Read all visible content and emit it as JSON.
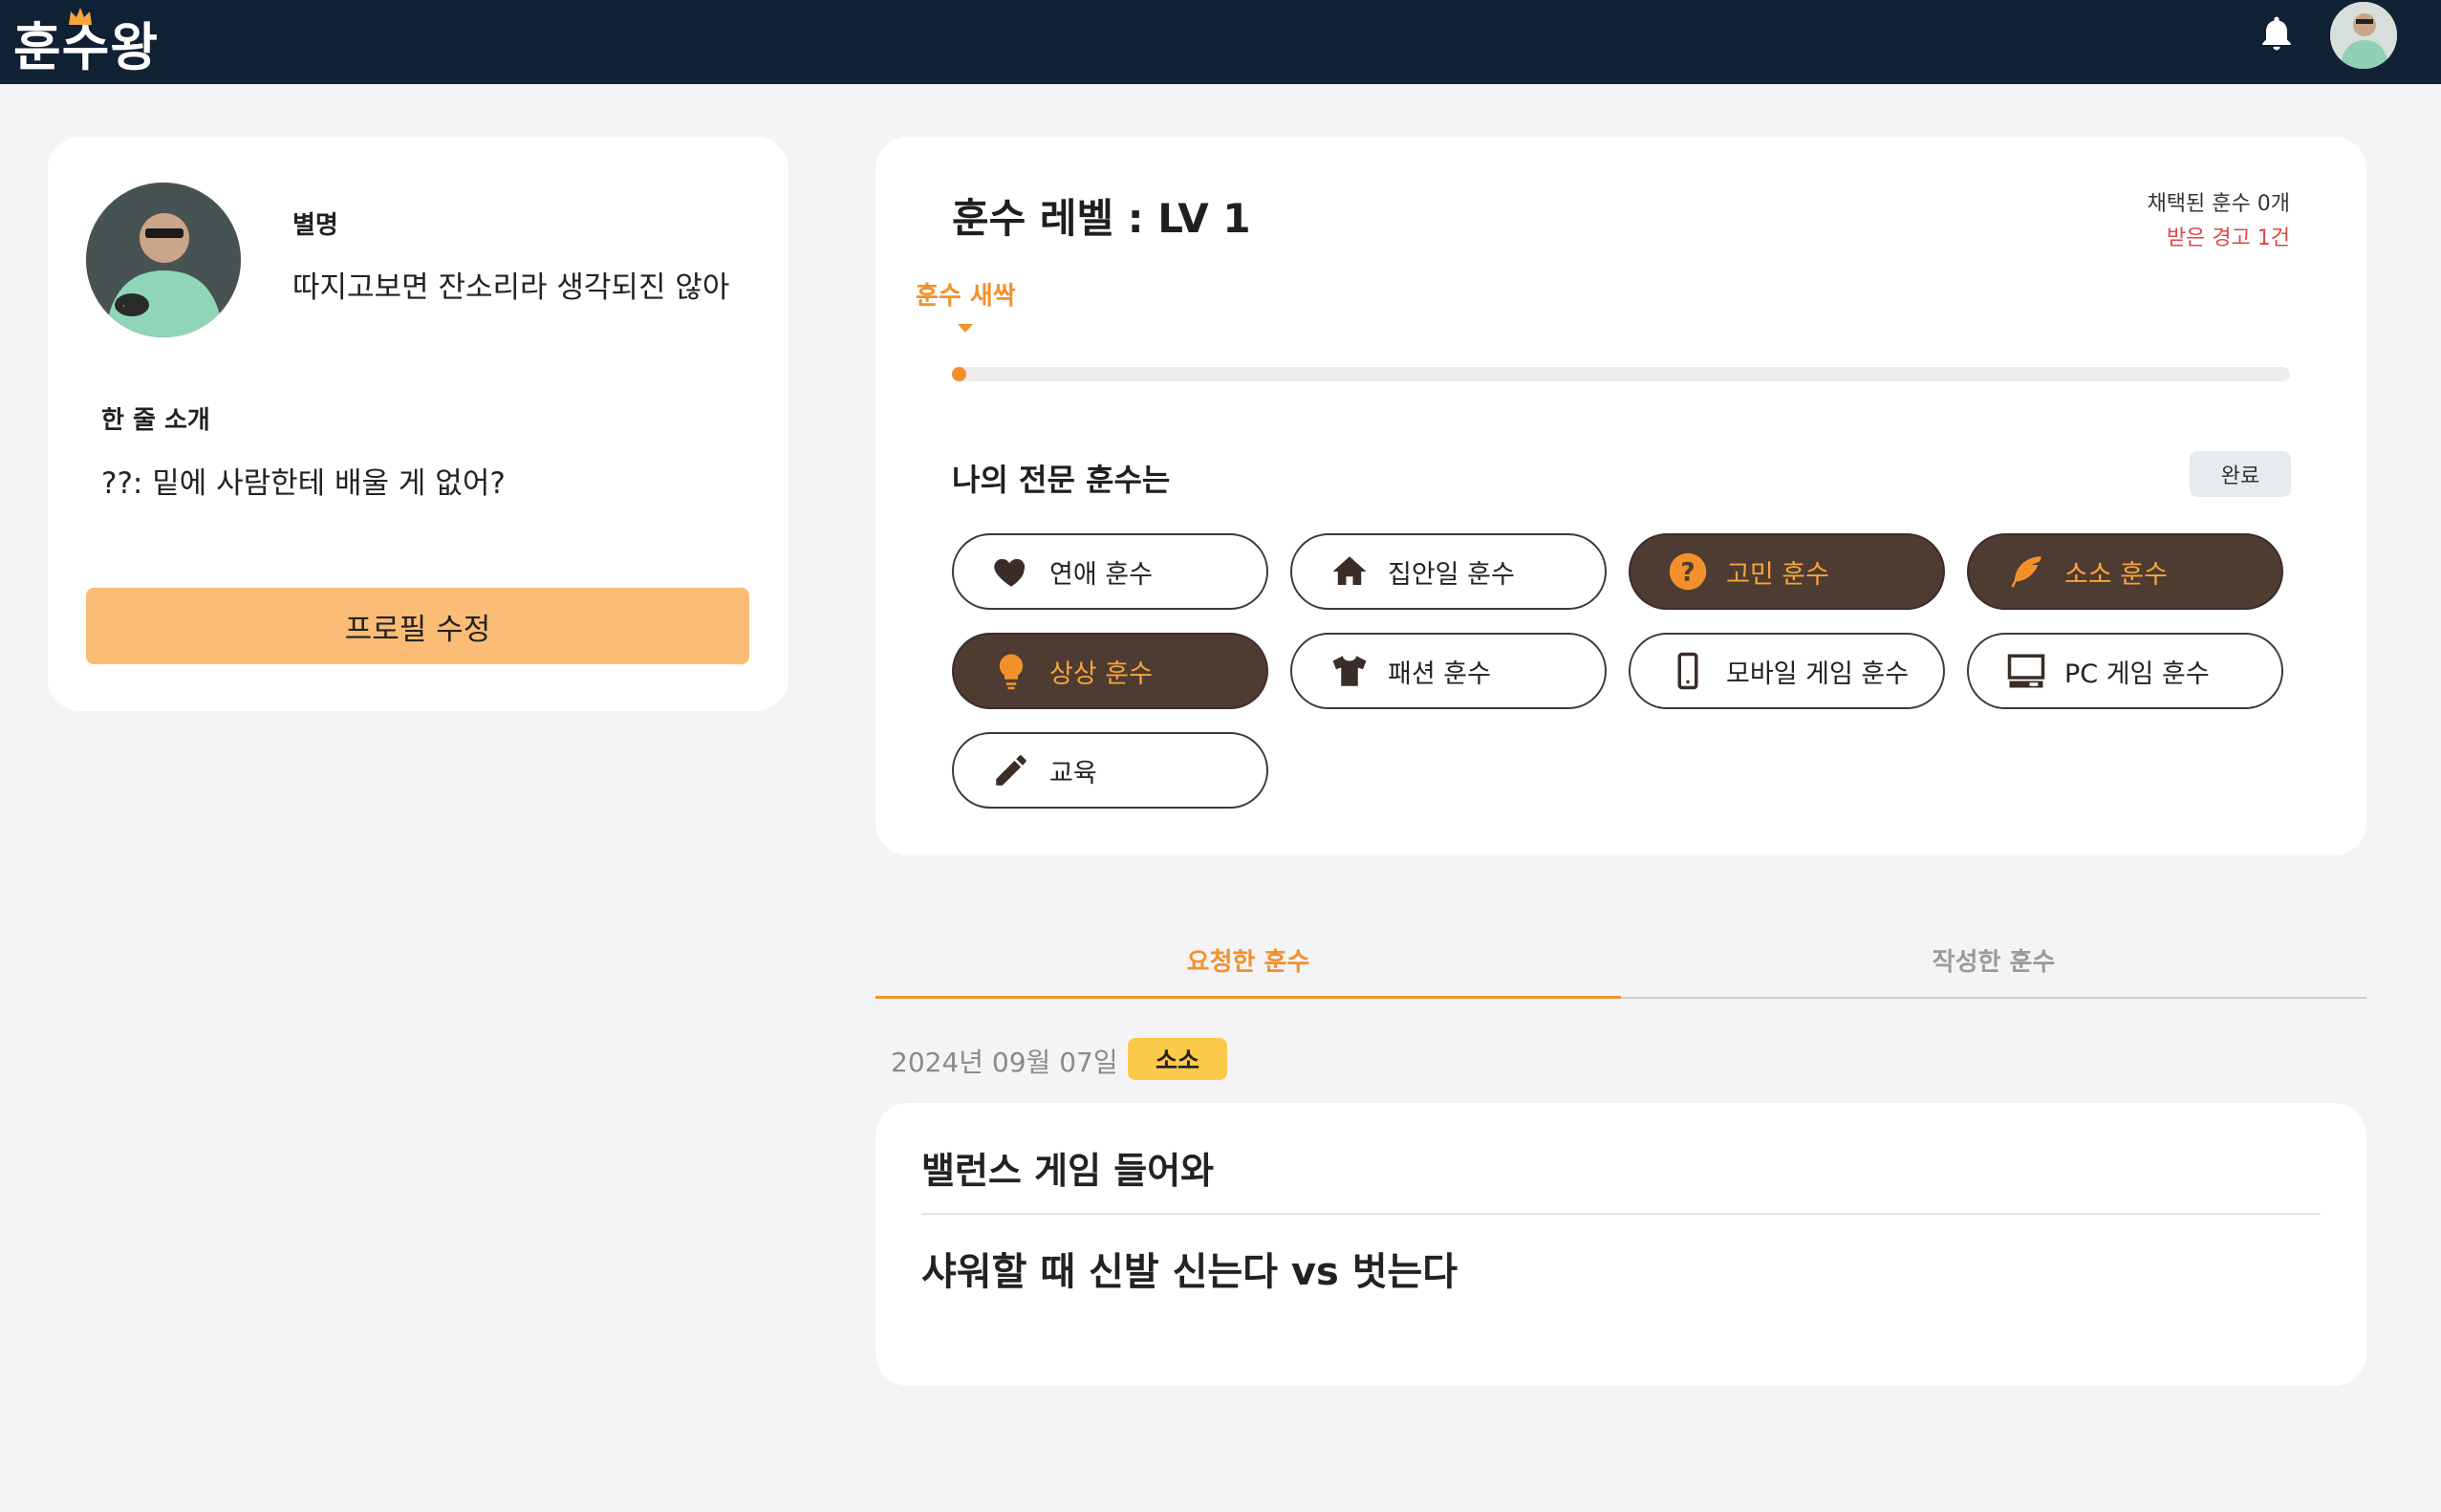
{
  "header": {
    "logo_text": "훈수왕",
    "bell_icon": "bell-icon",
    "avatar_icon": "user-avatar"
  },
  "profile": {
    "nickname_label": "별명",
    "nickname": "따지고보면 잔소리라 생각되진 않아",
    "intro_label": "한 줄 소개",
    "intro": "??: 밑에 사람한테 배울 게 없어?",
    "edit_button": "프로필 수정"
  },
  "level": {
    "title": "훈수 레벨 : LV 1",
    "adopted": "채택된 훈수 0개",
    "warning": "받은 경고 1건",
    "level_name": "훈수 새싹",
    "progress_percent": 1,
    "expert_title": "나의 전문 훈수는",
    "done_button": "완료"
  },
  "categories": [
    {
      "label": "연애 훈수",
      "icon": "heart-icon",
      "active": false
    },
    {
      "label": "집안일 훈수",
      "icon": "house-icon",
      "active": false
    },
    {
      "label": "고민 훈수",
      "icon": "question-icon",
      "active": true
    },
    {
      "label": "소소 훈수",
      "icon": "feather-icon",
      "active": true
    },
    {
      "label": "상상 훈수",
      "icon": "lightbulb-icon",
      "active": true
    },
    {
      "label": "패션 훈수",
      "icon": "shirt-icon",
      "active": false
    },
    {
      "label": "모바일 게임 훈수",
      "icon": "mobile-icon",
      "active": false
    },
    {
      "label": "PC 게임 훈수",
      "icon": "pc-icon",
      "active": false
    },
    {
      "label": "교육",
      "icon": "pencil-icon",
      "active": false
    }
  ],
  "tabs": {
    "requested": "요청한 훈수",
    "written": "작성한 훈수",
    "active": "requested"
  },
  "posts": [
    {
      "date": "2024년 09월 07일",
      "badge": "소소",
      "title": "밸런스 게임 들어와",
      "question": "샤워할 때 신발 신는다 vs 벗는다"
    }
  ],
  "colors": {
    "accent": "#f2912c",
    "header_bg": "#0f2133",
    "chip_active_bg": "#4e3b32",
    "edit_button_bg": "#fbbd75",
    "badge_bg": "#fdc94a",
    "warning": "#e04646"
  }
}
